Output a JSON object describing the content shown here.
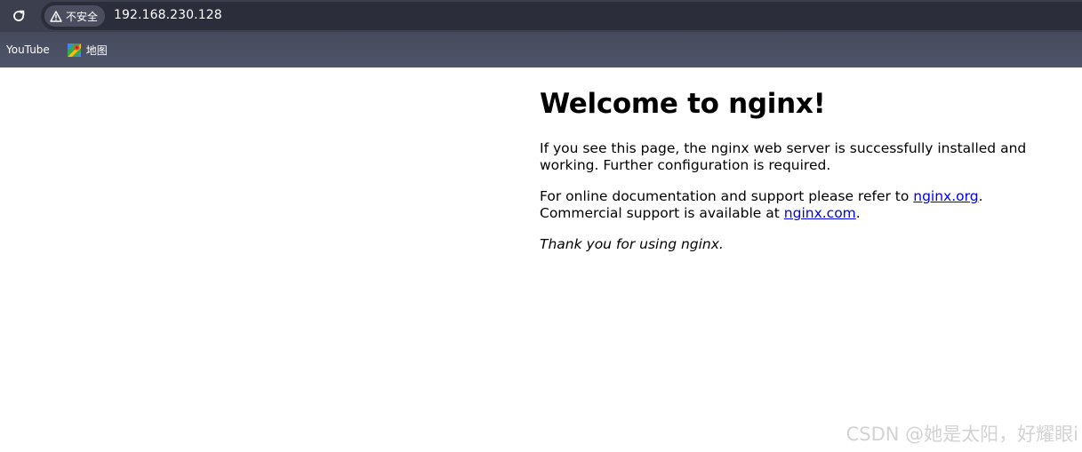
{
  "browser": {
    "security_label": "不安全",
    "url": "192.168.230.128",
    "bookmarks": [
      {
        "label": "YouTube"
      },
      {
        "label": "地图",
        "icon": "maps-icon"
      }
    ]
  },
  "page": {
    "heading": "Welcome to nginx!",
    "para1": "If you see this page, the nginx web server is successfully installed and working. Further configuration is required.",
    "para2_prefix": "For online documentation and support please refer to ",
    "link_org": "nginx.org",
    "para2_mid": ".",
    "para2_line2": "Commercial support is available at ",
    "link_com": "nginx.com",
    "para2_suffix": ".",
    "thanks": "Thank you for using nginx."
  },
  "watermark": "CSDN @她是太阳，好耀眼i",
  "colors": {
    "toolbar": "#3b3f4e",
    "address_bar": "#2b2e3a",
    "bookmarks_bar": "#4b4f62",
    "link": "#0000ee"
  }
}
